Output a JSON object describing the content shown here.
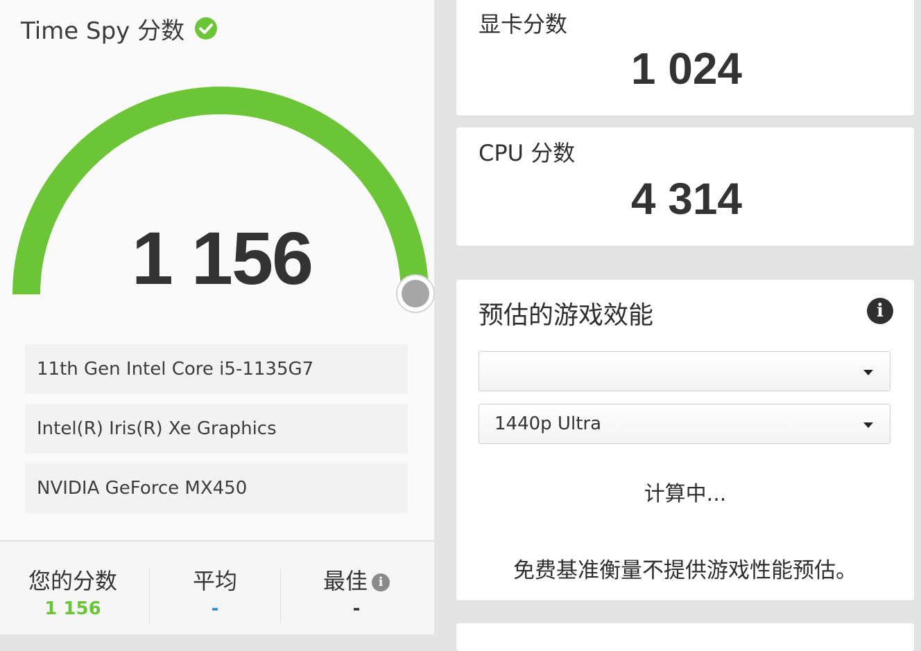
{
  "overall": {
    "title": "Time Spy 分数",
    "score": "1 156",
    "status_icon": "check-circle-icon",
    "accent_color": "#6cc537",
    "gauge_fill_fraction": 0.99
  },
  "hardware": [
    "11th Gen Intel Core i5-1135G7",
    "Intel(R) Iris(R) Xe Graphics",
    "NVIDIA GeForce MX450"
  ],
  "comparison": {
    "your_score_label": "您的分数",
    "your_score_value": "1 156",
    "average_label": "平均",
    "average_value": "-",
    "best_label": "最佳",
    "best_value": "-"
  },
  "gpu_card": {
    "title": "显卡分数",
    "score": "1 024"
  },
  "cpu_card": {
    "title": "CPU 分数",
    "score": "4 314"
  },
  "game_perf": {
    "title": "预估的游戏效能",
    "game_select_value": "",
    "preset_select_value": "1440p Ultra",
    "calculating_text": "计算中...",
    "notice_text": "免费基准衡量不提供游戏性能预估。"
  }
}
